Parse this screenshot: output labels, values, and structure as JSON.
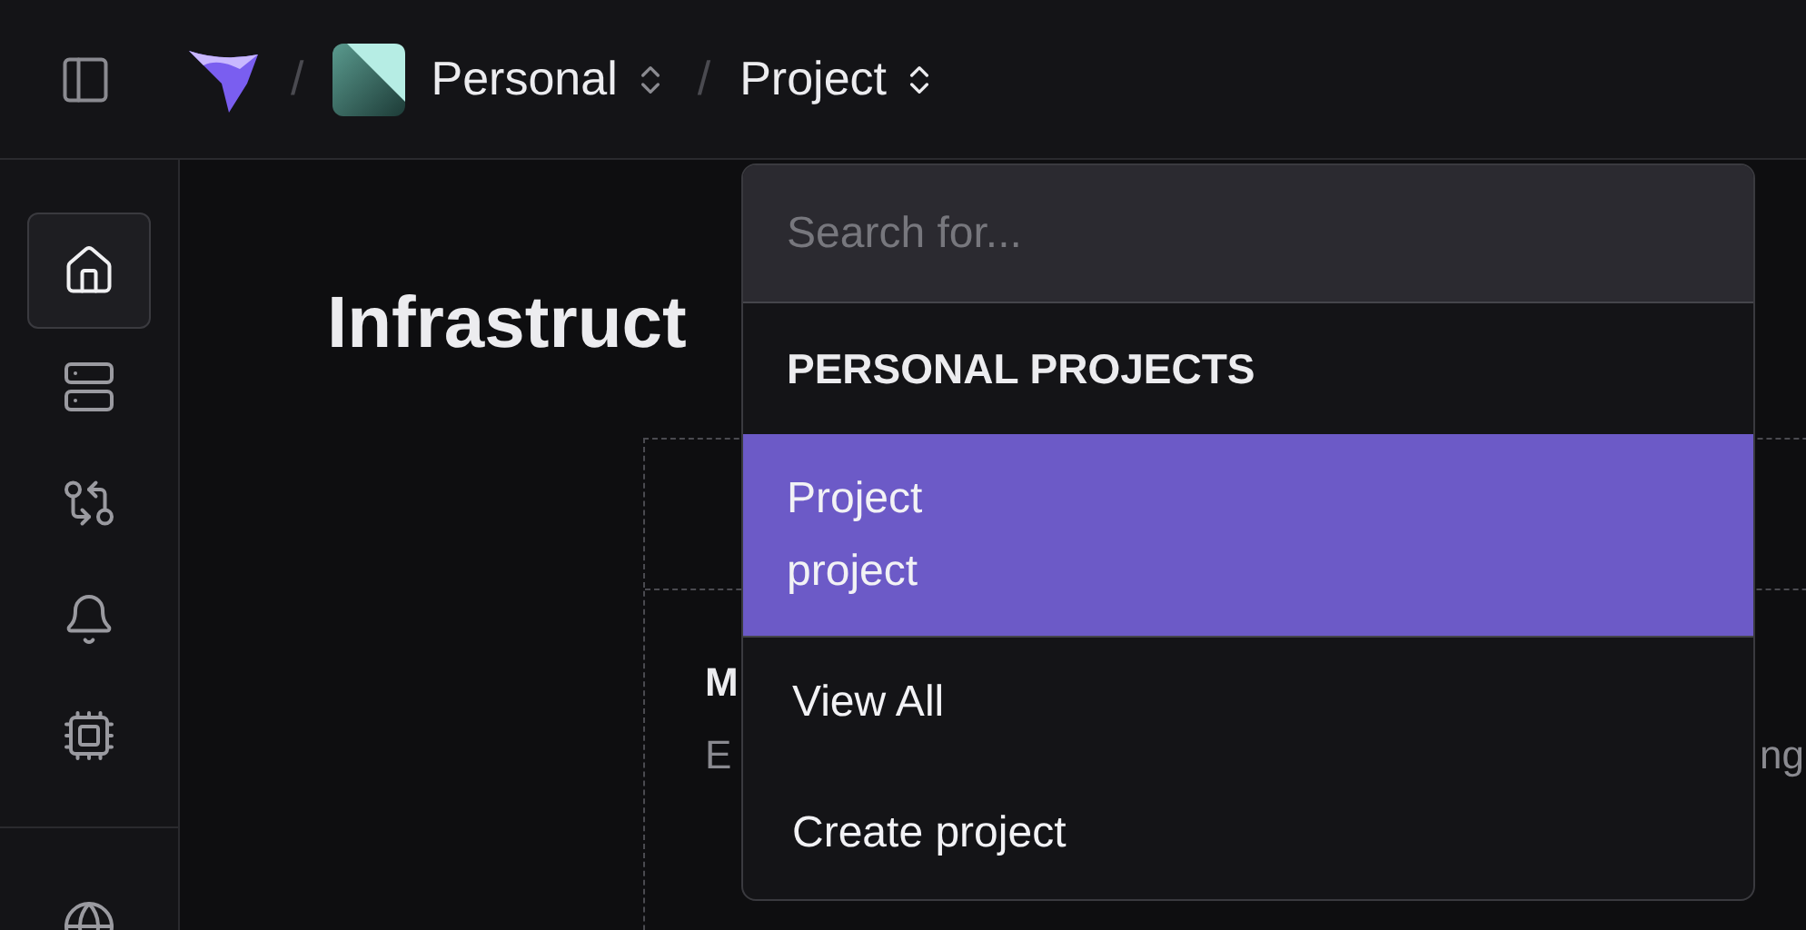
{
  "topbar": {
    "breadcrumbs": [
      {
        "kind": "team",
        "separator": "/",
        "label": "Personal"
      },
      {
        "kind": "project",
        "separator": "/",
        "label": "Project"
      }
    ]
  },
  "sidebar": {
    "items": [
      {
        "selected": true
      },
      {
        "selected": false
      },
      {
        "selected": false
      },
      {
        "selected": false
      },
      {
        "selected": false
      }
    ],
    "footer_items": [
      {
        "selected": false
      }
    ]
  },
  "main": {
    "title": "Infrastruct",
    "card": {
      "heading": "M",
      "description": "E",
      "description_end": "ng"
    }
  },
  "dropdown": {
    "search": {
      "placeholder": "Search for..."
    },
    "section": "PERSONAL PROJECTS",
    "projects": [
      {
        "name": "Project",
        "slug": "project",
        "selected": true
      }
    ],
    "actions": [
      "View All",
      "Create project"
    ]
  }
}
